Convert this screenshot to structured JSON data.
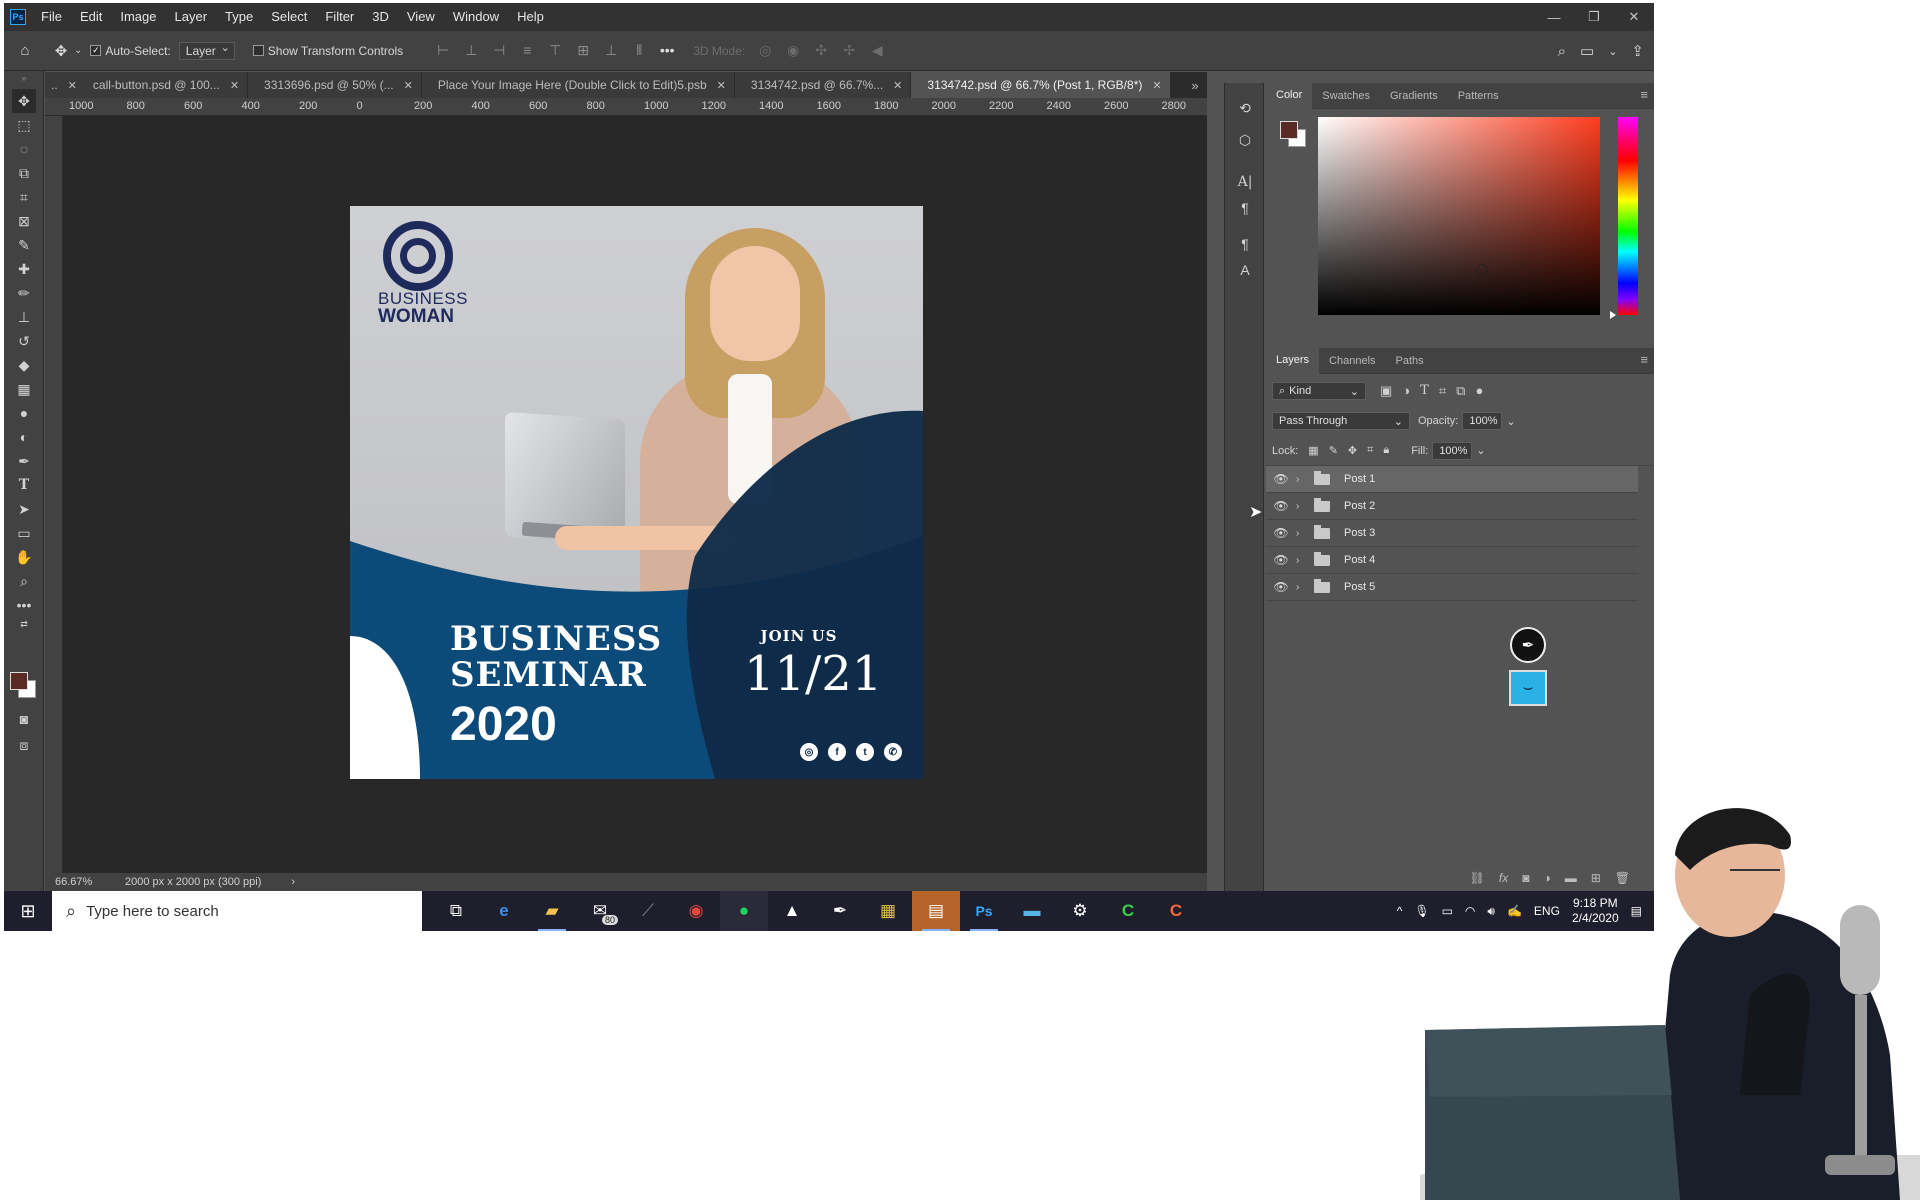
{
  "menubar": {
    "logo": "Ps",
    "items": [
      "File",
      "Edit",
      "Image",
      "Layer",
      "Type",
      "Select",
      "Filter",
      "3D",
      "View",
      "Window",
      "Help"
    ]
  },
  "options": {
    "auto_select_label": "Auto-Select:",
    "auto_select_value": "Layer",
    "show_transform_label": "Show Transform Controls",
    "mode_3d_label": "3D Mode:"
  },
  "tabs": [
    {
      "label": "call-button.psd @ 100..."
    },
    {
      "label": "3313696.psd @ 50% (..."
    },
    {
      "label": "Place Your Image Here (Double Click to Edit)5.psb"
    },
    {
      "label": "3134742.psd @ 66.7%..."
    },
    {
      "label": "3134742.psd @ 66.7% (Post 1, RGB/8*)"
    }
  ],
  "ruler_h": [
    "1000",
    "800",
    "600",
    "400",
    "200",
    "0",
    "200",
    "400",
    "600",
    "800",
    "1000",
    "1200",
    "1400",
    "1600",
    "1800",
    "2000",
    "2200",
    "2400",
    "2600",
    "2800"
  ],
  "artwork": {
    "logo_line1": "BUSINESS",
    "logo_line2": "WOMAN",
    "title_line1": "BUSINESS",
    "title_line2": "SEMINAR",
    "year": "2020",
    "join": "JOIN US",
    "date": "11/21",
    "colors": {
      "navy": "#0f2b48",
      "blue": "#0c4a7a",
      "logo": "#1f2a5c"
    }
  },
  "status": {
    "zoom": "66.67%",
    "dims": "2000 px x 2000 px (300 ppi)"
  },
  "color_panel": {
    "tabs": [
      "Color",
      "Swatches",
      "Gradients",
      "Patterns"
    ],
    "foreground": "#5a2a25",
    "background": "#ffffff"
  },
  "layers_panel": {
    "tabs": [
      "Layers",
      "Channels",
      "Paths"
    ],
    "filter_kind": "Kind",
    "blend_mode": "Pass Through",
    "opacity_label": "Opacity:",
    "opacity_value": "100%",
    "lock_label": "Lock:",
    "fill_label": "Fill:",
    "fill_value": "100%",
    "layers": [
      {
        "name": "Post 1",
        "selected": true
      },
      {
        "name": "Post 2",
        "selected": false
      },
      {
        "name": "Post 3",
        "selected": false
      },
      {
        "name": "Post 4",
        "selected": false
      },
      {
        "name": "Post 5",
        "selected": false
      }
    ]
  },
  "taskbar": {
    "search_placeholder": "Type here to search",
    "mail_badge": "80",
    "language": "ENG",
    "time": "9:18 PM",
    "date": "2/4/2020"
  }
}
